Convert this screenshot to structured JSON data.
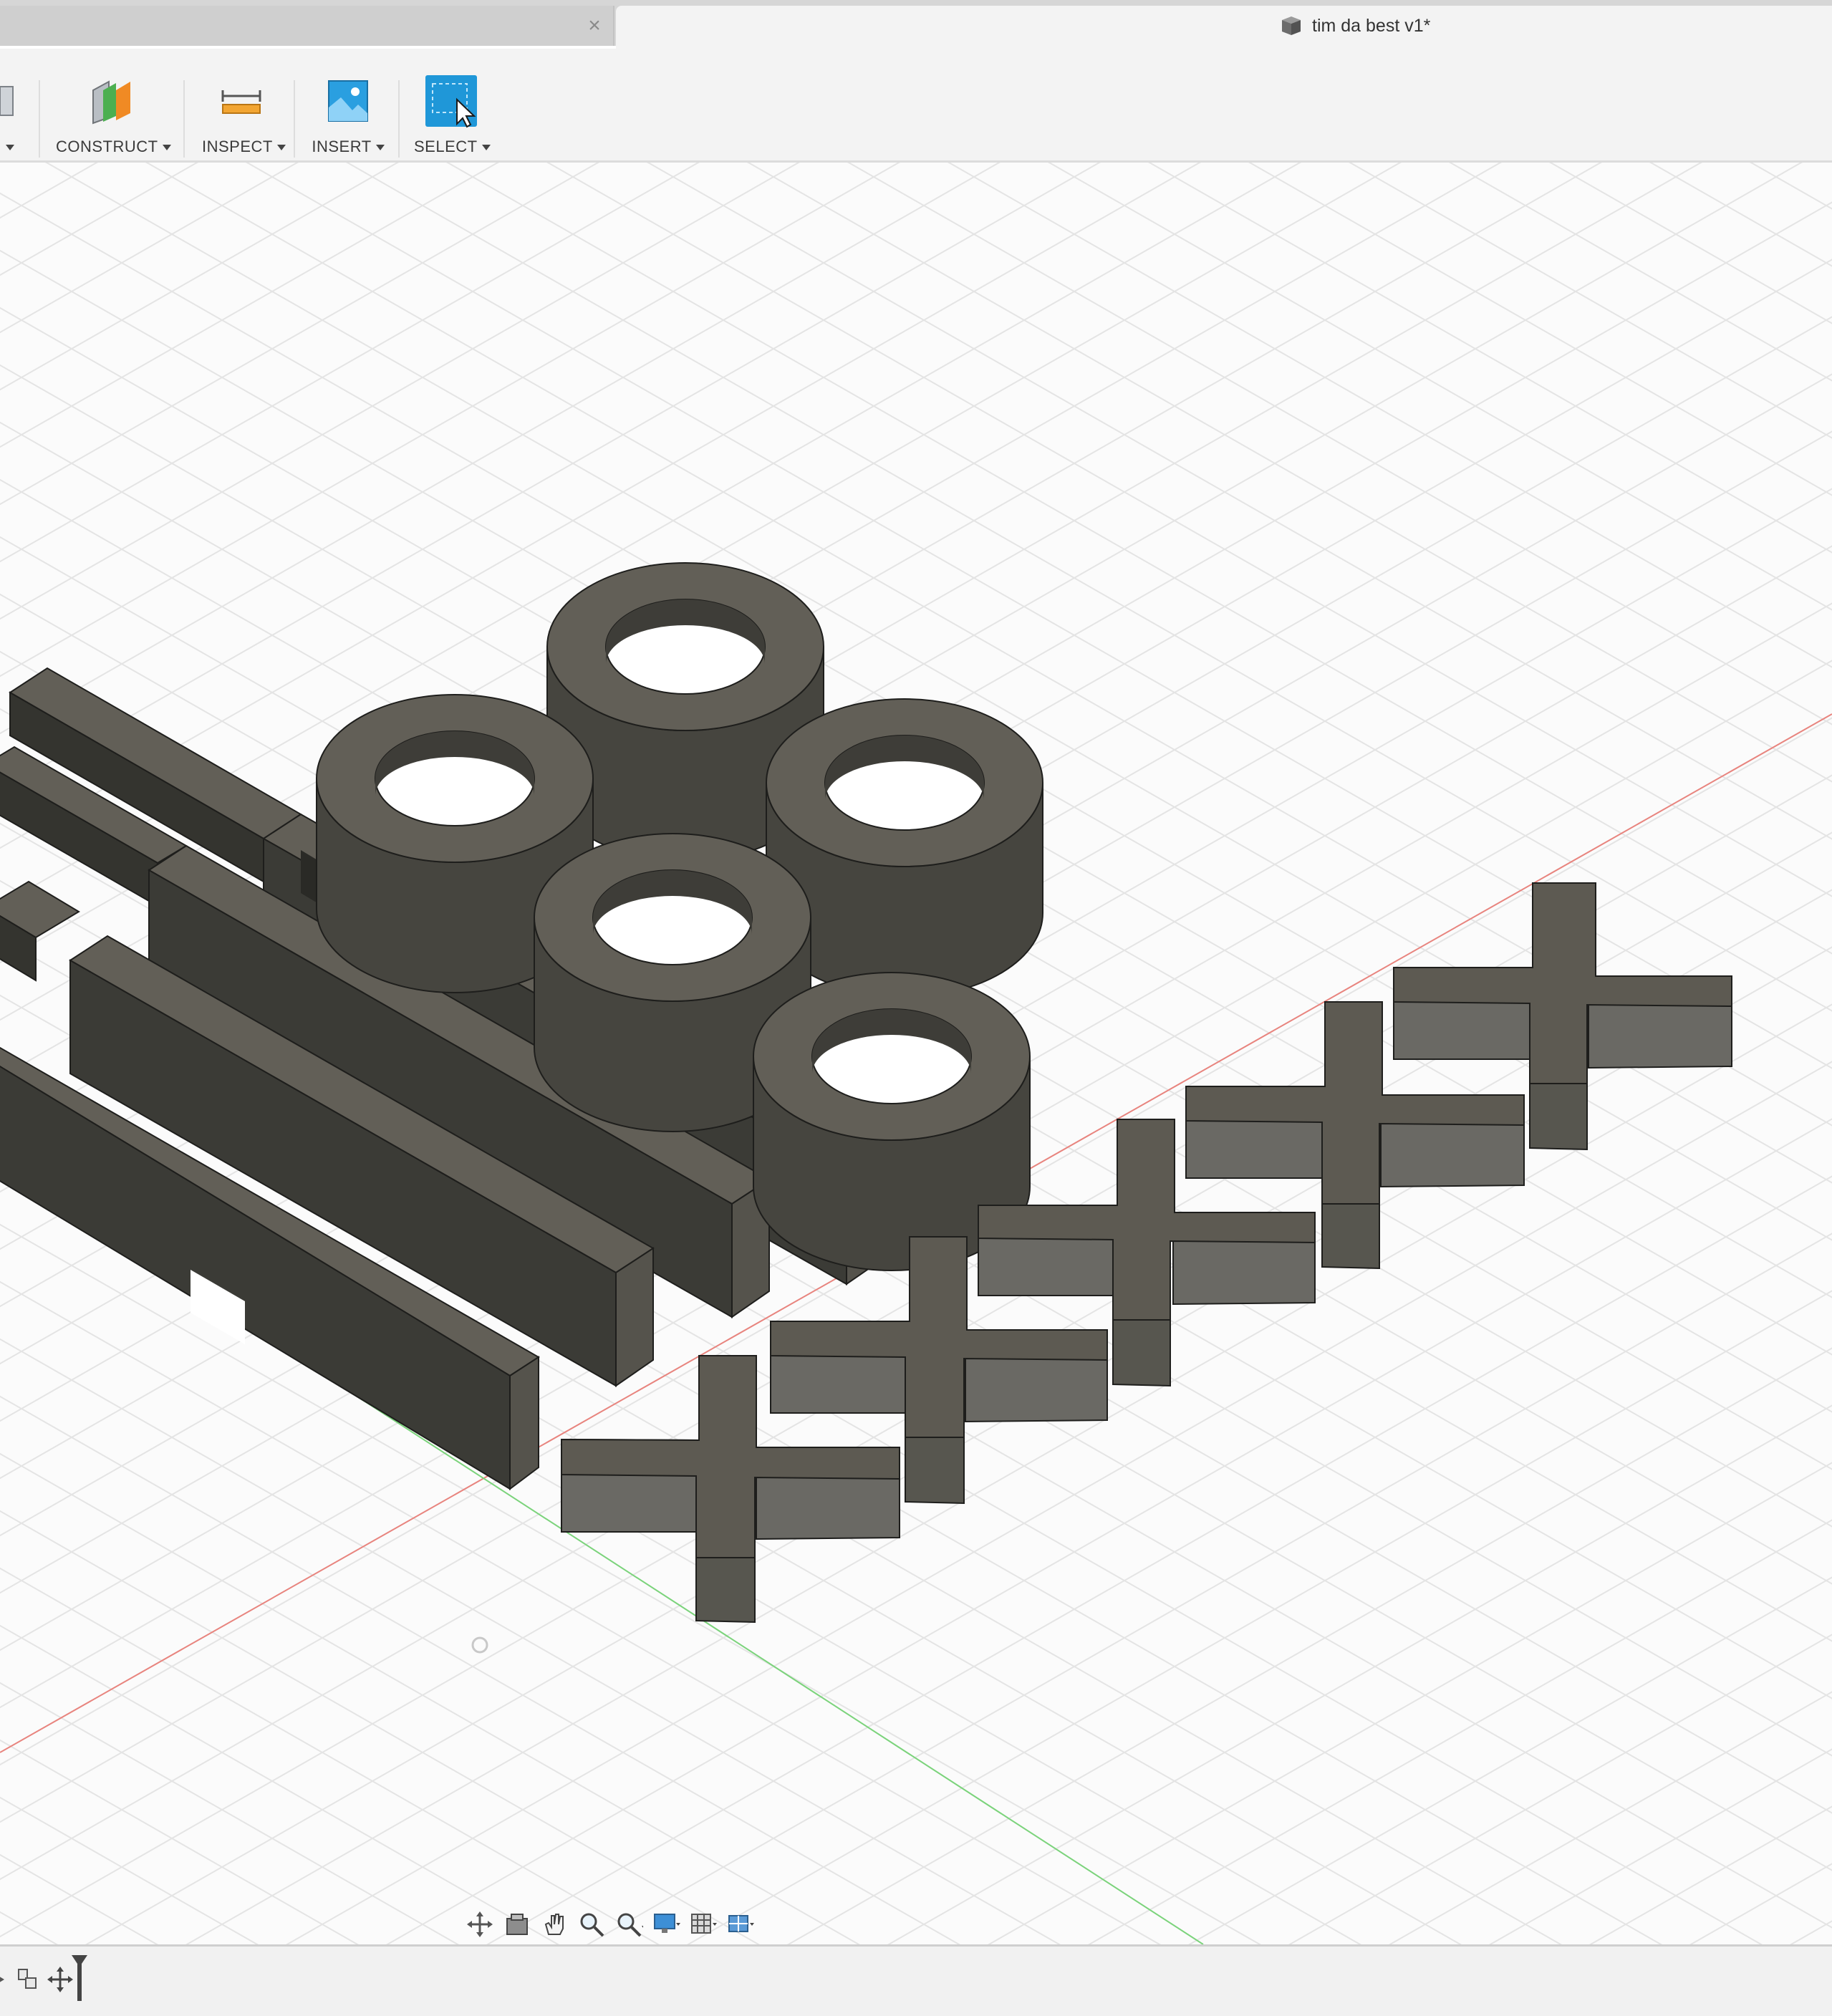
{
  "tabs": {
    "active_title": "tim da best v1*",
    "close_glyph": "×"
  },
  "toolbar": {
    "items": [
      {
        "label": "CONSTRUCT",
        "icon": "construct-plane-icon"
      },
      {
        "label": "INSPECT",
        "icon": "measure-ruler-icon"
      },
      {
        "label": "INSERT",
        "icon": "insert-image-icon"
      },
      {
        "label": "SELECT",
        "icon": "select-cursor-icon"
      }
    ]
  },
  "colors": {
    "body": "#5a5750",
    "top_face": "#625f57",
    "dark_face": "#34342f",
    "light_face": "#6a6964",
    "x_axis": "#e8847e",
    "y_axis": "#7bd37b",
    "accent_select": "#1f97d8"
  },
  "nav_toolbar": {
    "icons": [
      "orbit-icon",
      "look-at-icon",
      "pan-hand-icon",
      "zoom-icon",
      "zoom-window-icon",
      "display-settings-icon",
      "grid-settings-icon",
      "viewports-icon"
    ]
  },
  "timeline": {
    "icons": [
      "timeline-step-icon",
      "timeline-feature-icon",
      "timeline-move-icon",
      "timeline-marker-icon"
    ]
  }
}
